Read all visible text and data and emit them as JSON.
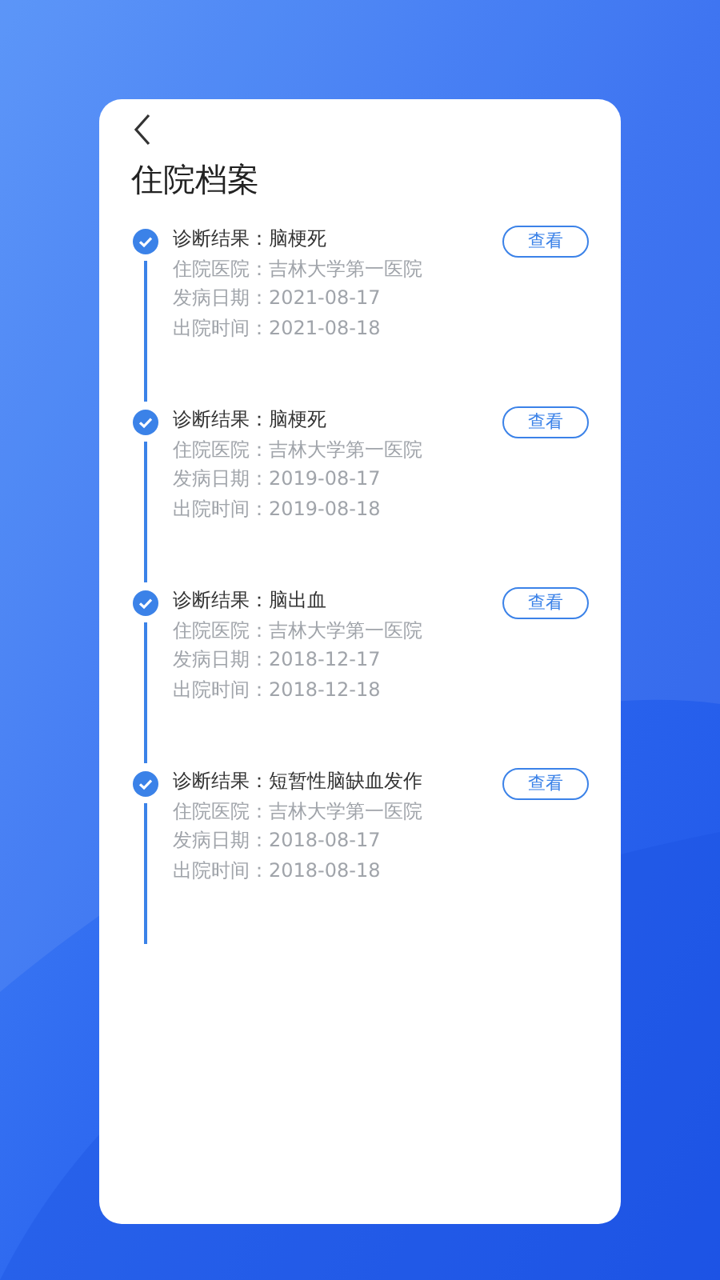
{
  "title": "住院档案",
  "records": [
    {
      "diagnosis": "诊断结果：脑梗死",
      "hospital": "住院医院：吉林大学第一医院",
      "onset": "发病日期：2021-08-17",
      "discharge": "出院时间：2021-08-18",
      "button": "查看"
    },
    {
      "diagnosis": "诊断结果：脑梗死",
      "hospital": "住院医院：吉林大学第一医院",
      "onset": "发病日期：2019-08-17",
      "discharge": "出院时间：2019-08-18",
      "button": "查看"
    },
    {
      "diagnosis": "诊断结果：脑出血",
      "hospital": "住院医院：吉林大学第一医院",
      "onset": "发病日期：2018-12-17",
      "discharge": "出院时间：2018-12-18",
      "button": "查看"
    },
    {
      "diagnosis": "诊断结果：短暂性脑缺血发作",
      "hospital": "住院医院：吉林大学第一医院",
      "onset": "发病日期：2018-08-17",
      "discharge": "出院时间：2018-08-18",
      "button": "查看"
    }
  ]
}
